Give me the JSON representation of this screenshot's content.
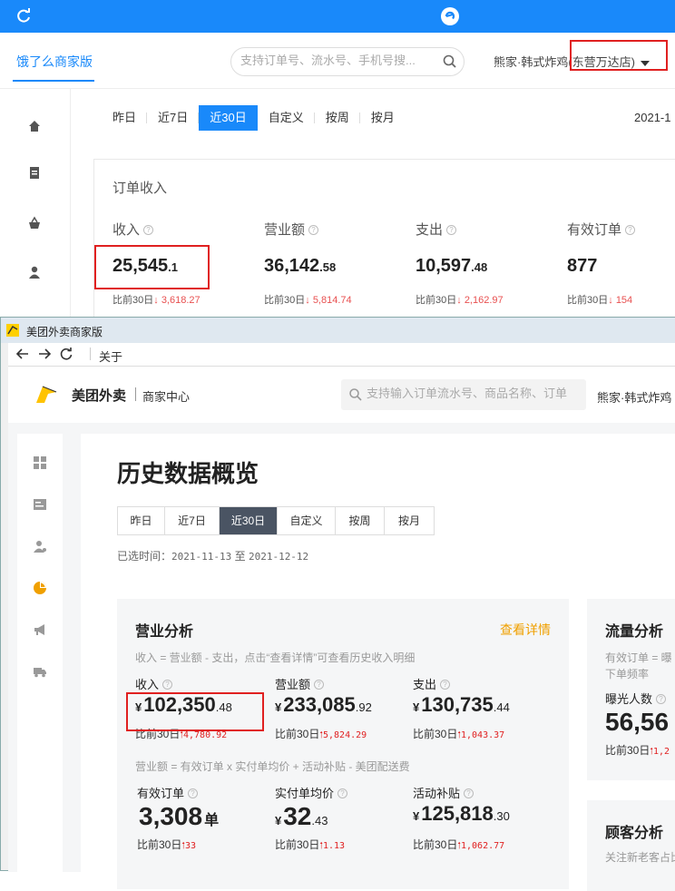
{
  "eleme": {
    "brand": "饿了么商家版",
    "search_placeholder": "支持订单号、流水号、手机号搜...",
    "shop_name": "熊家·韩式炸鸡",
    "shop_branch": "(东营万达店)",
    "tabs": [
      "昨日",
      "近7日",
      "近30日",
      "自定义",
      "按周",
      "按月"
    ],
    "active_tab": "近30日",
    "date_partial": "2021-1",
    "card_title": "订单收入",
    "metrics": [
      {
        "label": "收入",
        "int": "25,545",
        "dec": ".1",
        "cmp_prefix": "比前30日",
        "cmp_arrow": "↓",
        "cmp_value": "3,618.27"
      },
      {
        "label": "营业额",
        "int": "36,142",
        "dec": ".58",
        "cmp_prefix": "比前30日",
        "cmp_arrow": "↓",
        "cmp_value": "5,814.74"
      },
      {
        "label": "支出",
        "int": "10,597",
        "dec": ".48",
        "cmp_prefix": "比前30日",
        "cmp_arrow": "↓",
        "cmp_value": "2,162.97"
      },
      {
        "label": "有效订单",
        "int": "877",
        "dec": "",
        "cmp_prefix": "比前30日",
        "cmp_arrow": "↓",
        "cmp_value": "154"
      }
    ],
    "colors": {
      "primary": "#1989fa",
      "highlight": "#e02020",
      "down": "#e85050"
    }
  },
  "meituan": {
    "window_title": "美团外卖商家版",
    "nav_about": "关于",
    "brand": "美团外卖",
    "brand_sub": "商家中心",
    "search_placeholder": "支持输入订单流水号、商品名称、订单",
    "shop_name": "熊家·韩式炸鸡",
    "page_title": "历史数据概览",
    "tabs": [
      "昨日",
      "近7日",
      "近30日",
      "自定义",
      "按周",
      "按月"
    ],
    "active_tab": "近30日",
    "range_label": "已选时间：",
    "range_start": "2021-11-13",
    "range_to": "至",
    "range_end": "2021-12-12",
    "card": {
      "title": "营业分析",
      "link": "查看详情",
      "desc": "收入 = 营业额 - 支出，点击“查看详情”可查看历史收入明细",
      "desc2": "营业额 = 有效订单 x 实付单均价 + 活动补贴 - 美团配送费",
      "metrics": [
        {
          "label": "收入",
          "cur": "¥",
          "int": "102,350",
          "dec": ".48",
          "unit": "",
          "cmp_prefix": "比前30日",
          "cmp_arrow": "🠑",
          "cmp_value": "4,780.92"
        },
        {
          "label": "营业额",
          "cur": "¥",
          "int": "233,085",
          "dec": ".92",
          "unit": "",
          "cmp_prefix": "比前30日",
          "cmp_arrow": "🠑",
          "cmp_value": "5,824.29"
        },
        {
          "label": "支出",
          "cur": "¥",
          "int": "130,735",
          "dec": ".44",
          "unit": "",
          "cmp_prefix": "比前30日",
          "cmp_arrow": "🠑",
          "cmp_value": "1,043.37"
        },
        {
          "label": "有效订单",
          "cur": "",
          "int": "3,308",
          "dec": "",
          "unit": "单",
          "cmp_prefix": "比前30日",
          "cmp_arrow": "🠑",
          "cmp_value": "33"
        },
        {
          "label": "实付单均价",
          "cur": "¥",
          "int": "32",
          "dec": ".43",
          "unit": "",
          "cmp_prefix": "比前30日",
          "cmp_arrow": "🠑",
          "cmp_value": "1.13"
        },
        {
          "label": "活动补贴",
          "cur": "¥",
          "int": "125,818",
          "dec": ".30",
          "unit": "",
          "cmp_prefix": "比前30日",
          "cmp_arrow": "🠑",
          "cmp_value": "1,062.77"
        }
      ]
    },
    "side_card": {
      "title": "流量分析",
      "desc_line1": "有效订单 = 曝",
      "desc_line2": "下单频率",
      "metric_label": "曝光人数",
      "metric_value": "56,56",
      "cmp_prefix": "比前30日",
      "cmp_value": "1,2"
    },
    "side_card2": {
      "title": "顾客分析",
      "desc": "关注新老客占比"
    },
    "colors": {
      "accent": "#f0a000",
      "active_tab": "#4a5463",
      "highlight": "#e02020",
      "up": "#e02020"
    }
  }
}
